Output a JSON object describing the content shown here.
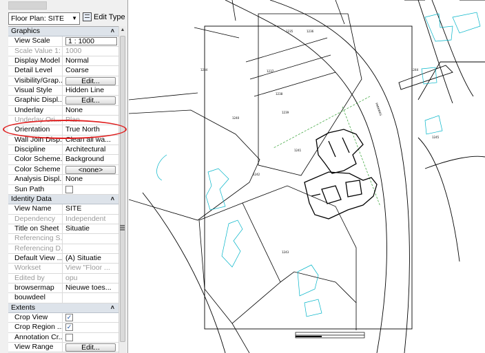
{
  "properties": {
    "type_selector": "Floor Plan: SITE",
    "edit_type_label": "Edit Type",
    "groups": [
      {
        "title": "Graphics",
        "rows": [
          {
            "label": "View Scale",
            "value": "1 : 1000",
            "kind": "input"
          },
          {
            "label": "Scale Value 1:",
            "value": "1000",
            "disabled": true
          },
          {
            "label": "Display Model",
            "value": "Normal"
          },
          {
            "label": "Detail Level",
            "value": "Coarse"
          },
          {
            "label": "Visibility/Grap...",
            "value": "Edit...",
            "kind": "button"
          },
          {
            "label": "Visual Style",
            "value": "Hidden Line"
          },
          {
            "label": "Graphic Displ...",
            "value": "Edit...",
            "kind": "button"
          },
          {
            "label": "Underlay",
            "value": "None"
          },
          {
            "label": "Underlay Ori...",
            "value": "Plan",
            "disabled": true
          },
          {
            "label": "Orientation",
            "value": "True North"
          },
          {
            "label": "Wall Join Disp...",
            "value": "Clean all wa..."
          },
          {
            "label": "Discipline",
            "value": "Architectural"
          },
          {
            "label": "Color Scheme...",
            "value": "Background"
          },
          {
            "label": "Color Scheme",
            "value": "<none>",
            "kind": "button"
          },
          {
            "label": "Analysis Displ...",
            "value": "None"
          },
          {
            "label": "Sun Path",
            "value": "",
            "kind": "check",
            "checked": false
          }
        ]
      },
      {
        "title": "Identity Data",
        "rows": [
          {
            "label": "View Name",
            "value": "SITE"
          },
          {
            "label": "Dependency",
            "value": "Independent",
            "disabled": true
          },
          {
            "label": "Title on Sheet",
            "value": "Situatie"
          },
          {
            "label": "Referencing S...",
            "value": "",
            "disabled": true
          },
          {
            "label": "Referencing D...",
            "value": "",
            "disabled": true
          },
          {
            "label": "Default View ...",
            "value": "(A) Situatie"
          },
          {
            "label": "Workset",
            "value": "View \"Floor ...",
            "disabled": true
          },
          {
            "label": "Edited by",
            "value": "opu",
            "disabled": true
          },
          {
            "label": "browsermap",
            "value": "Nieuwe toes..."
          },
          {
            "label": "bouwdeel",
            "value": ""
          }
        ]
      },
      {
        "title": "Extents",
        "rows": [
          {
            "label": "Crop View",
            "value": "",
            "kind": "check",
            "checked": true
          },
          {
            "label": "Crop Region ...",
            "value": "",
            "kind": "check",
            "checked": true
          },
          {
            "label": "Annotation Cr...",
            "value": "",
            "kind": "check",
            "checked": false
          },
          {
            "label": "View Range",
            "value": "Edit...",
            "kind": "button"
          }
        ]
      }
    ]
  },
  "drawing": {
    "road_label": "PARKWEG",
    "parcel_labels": [
      "1234",
      "1235",
      "1236",
      "1237",
      "1238",
      "1239",
      "1240",
      "1241",
      "1242",
      "1243",
      "1244",
      "1245"
    ],
    "colors": {
      "linework": "#000000",
      "existing": "#00b4c8",
      "grid": "#2f9e2f",
      "highlight": "#e02020"
    }
  }
}
